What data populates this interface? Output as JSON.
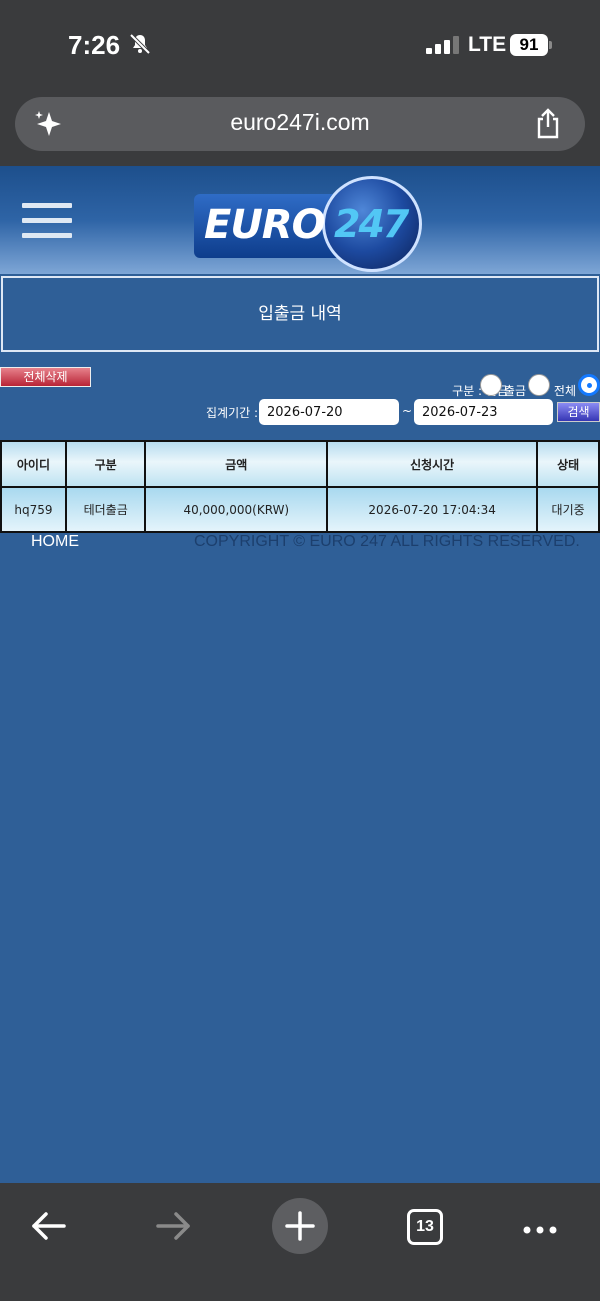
{
  "status_bar": {
    "time": "7:26",
    "network": "LTE",
    "battery": "91"
  },
  "browser": {
    "url": "euro247i.com",
    "tab_count": "13"
  },
  "site": {
    "logo_text": "EURO",
    "logo_number": "247",
    "page_title": "입출금 내역",
    "delete_all_label": "전체삭제"
  },
  "filter": {
    "type_label": "구분 : 입금",
    "withdraw_label": "출금",
    "all_label": "전체",
    "selected": "전체",
    "period_label": "집계기간 :",
    "date_from": "2026-07-20",
    "date_to": "2026-07-23",
    "tilde": "~",
    "search_label": "검색"
  },
  "table": {
    "headers": [
      "아이디",
      "구분",
      "금액",
      "신청시간",
      "상태"
    ],
    "rows": [
      [
        "hq759",
        "테더출금",
        "40,000,000(KRW)",
        "2026-07-20 17:04:34",
        "대기중"
      ]
    ]
  },
  "footer": {
    "home_label": "HOME",
    "copyright": "COPYRIGHT © EURO 247 ALL RIGHTS RESERVED."
  },
  "colors": {
    "page_bg": "#2f5f97",
    "delete_btn": "#b82436",
    "search_btn": "#3636b4",
    "radio_selected": "#1479ff"
  }
}
